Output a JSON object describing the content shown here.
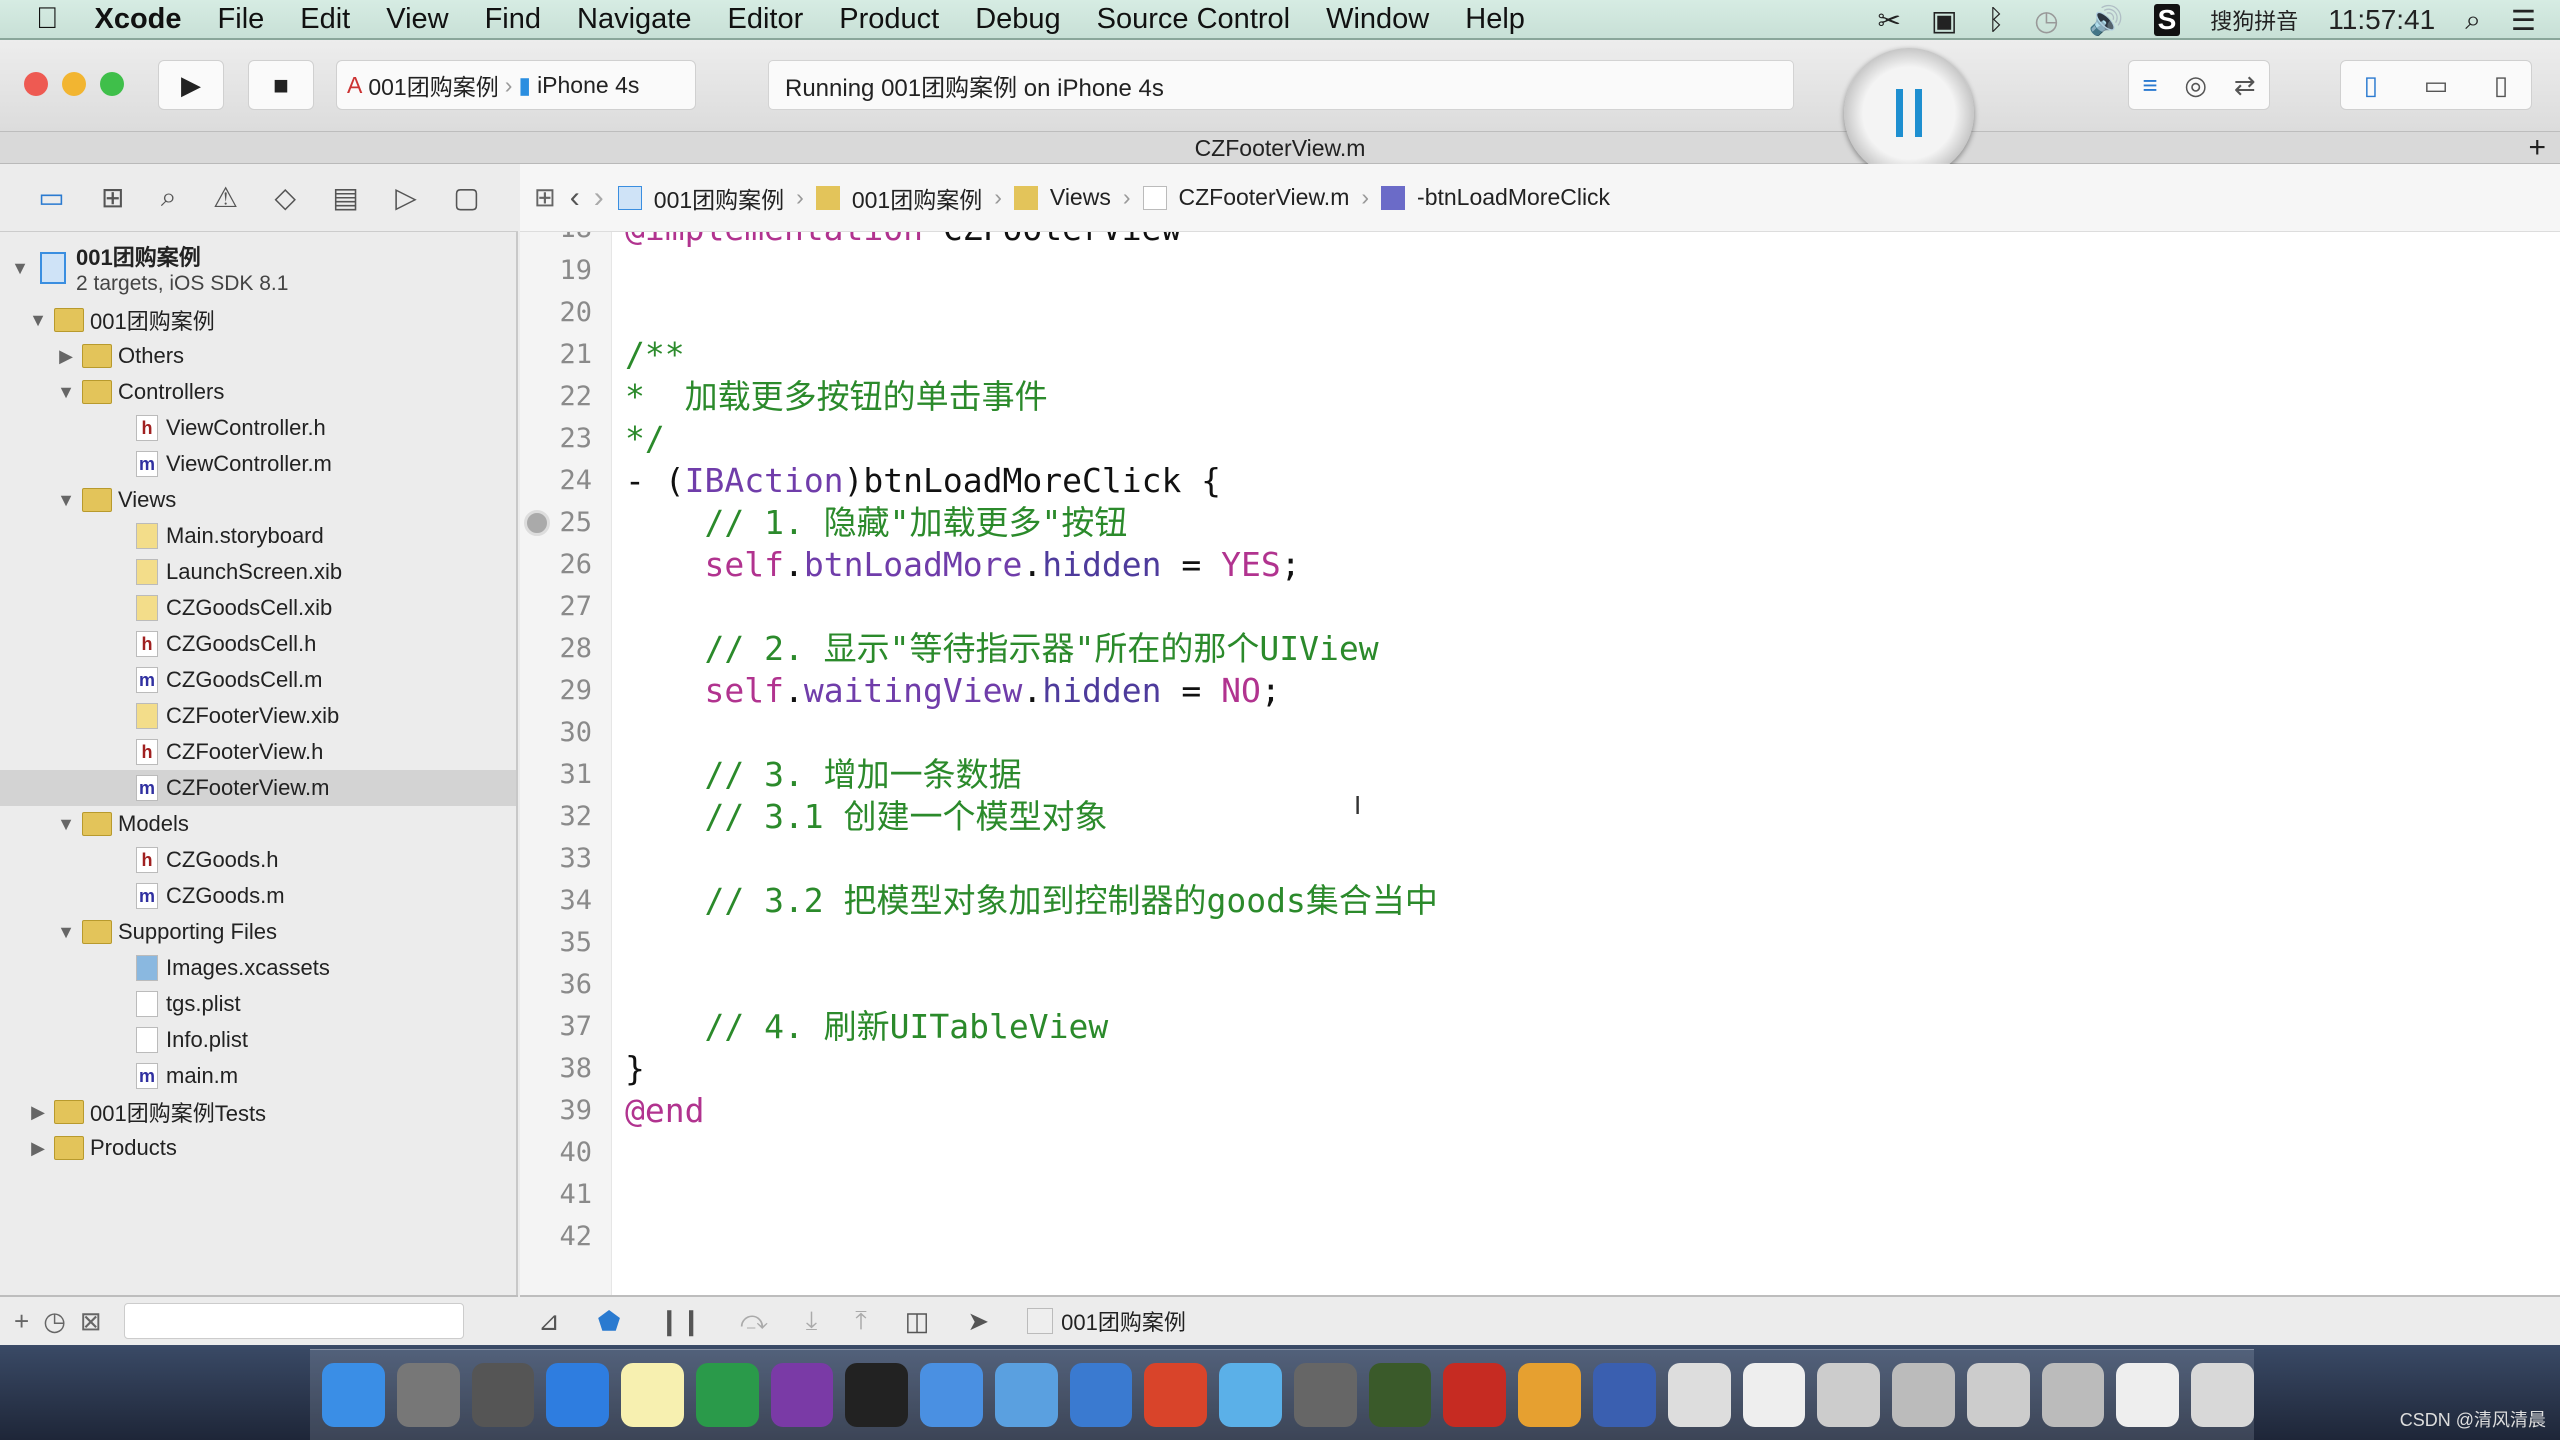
{
  "menubar": {
    "apple": "",
    "items": [
      "Xcode",
      "File",
      "Edit",
      "View",
      "Find",
      "Navigate",
      "Editor",
      "Product",
      "Debug",
      "Source Control",
      "Window",
      "Help"
    ],
    "input_method": "搜狗拼音",
    "clock": "11:57:41"
  },
  "toolbar": {
    "scheme": "001团购案例",
    "device": "iPhone 4s",
    "status": "Running 001团购案例 on iPhone 4s"
  },
  "tab": {
    "title": "CZFooterView.m"
  },
  "jumpbar": [
    "001团购案例",
    "001团购案例",
    "Views",
    "CZFooterView.m",
    "-btnLoadMoreClick"
  ],
  "navigator": {
    "project": {
      "name": "001团购案例",
      "subtitle": "2 targets, iOS SDK 8.1"
    },
    "items": [
      {
        "label": "001团购案例",
        "kind": "folder",
        "depth": 0,
        "open": true
      },
      {
        "label": "Others",
        "kind": "folder",
        "depth": 1,
        "open": false
      },
      {
        "label": "Controllers",
        "kind": "folder",
        "depth": 1,
        "open": true
      },
      {
        "label": "ViewController.h",
        "kind": "h",
        "depth": 2
      },
      {
        "label": "ViewController.m",
        "kind": "m",
        "depth": 2
      },
      {
        "label": "Views",
        "kind": "folder",
        "depth": 1,
        "open": true
      },
      {
        "label": "Main.storyboard",
        "kind": "ib",
        "depth": 2
      },
      {
        "label": "LaunchScreen.xib",
        "kind": "ib",
        "depth": 2
      },
      {
        "label": "CZGoodsCell.xib",
        "kind": "ib",
        "depth": 2
      },
      {
        "label": "CZGoodsCell.h",
        "kind": "h",
        "depth": 2
      },
      {
        "label": "CZGoodsCell.m",
        "kind": "m",
        "depth": 2
      },
      {
        "label": "CZFooterView.xib",
        "kind": "ib",
        "depth": 2
      },
      {
        "label": "CZFooterView.h",
        "kind": "h",
        "depth": 2
      },
      {
        "label": "CZFooterView.m",
        "kind": "m",
        "depth": 2,
        "selected": true
      },
      {
        "label": "Models",
        "kind": "folder",
        "depth": 1,
        "open": true
      },
      {
        "label": "CZGoods.h",
        "kind": "h",
        "depth": 2
      },
      {
        "label": "CZGoods.m",
        "kind": "m",
        "depth": 2
      },
      {
        "label": "Supporting Files",
        "kind": "folder",
        "depth": 1,
        "open": true
      },
      {
        "label": "Images.xcassets",
        "kind": "assets",
        "depth": 2
      },
      {
        "label": "tgs.plist",
        "kind": "plist",
        "depth": 2
      },
      {
        "label": "Info.plist",
        "kind": "plist",
        "depth": 2
      },
      {
        "label": "main.m",
        "kind": "m",
        "depth": 2
      },
      {
        "label": "001团购案例Tests",
        "kind": "folder",
        "depth": 0,
        "open": false
      },
      {
        "label": "Products",
        "kind": "folder",
        "depth": 0,
        "open": false
      }
    ]
  },
  "code": {
    "first_line": 18,
    "breakpoint_line": 25,
    "lines": [
      [
        {
          "t": "@implementation",
          "c": "kw"
        },
        {
          "t": " CZFooterView",
          "c": "pl"
        }
      ],
      [],
      [],
      [
        {
          "t": "/**",
          "c": "cm"
        }
      ],
      [
        {
          "t": "*  加载更多按钮的单击事件",
          "c": "cm"
        }
      ],
      [
        {
          "t": "*/",
          "c": "cm"
        }
      ],
      [
        {
          "t": "- (",
          "c": "pl"
        },
        {
          "t": "IBAction",
          "c": "ty"
        },
        {
          "t": ")btnLoadMoreClick {",
          "c": "pl"
        }
      ],
      [
        {
          "t": "    // 1. 隐藏\"加载更多\"按钮",
          "c": "cm"
        }
      ],
      [
        {
          "t": "    self",
          "c": "kw"
        },
        {
          "t": ".",
          "c": "pl"
        },
        {
          "t": "btnLoadMore",
          "c": "ty"
        },
        {
          "t": ".",
          "c": "pl"
        },
        {
          "t": "hidden",
          "c": "pr"
        },
        {
          "t": " = ",
          "c": "pl"
        },
        {
          "t": "YES",
          "c": "kw"
        },
        {
          "t": ";",
          "c": "pl"
        }
      ],
      [],
      [
        {
          "t": "    // 2. 显示\"等待指示器\"所在的那个UIView",
          "c": "cm"
        }
      ],
      [
        {
          "t": "    self",
          "c": "kw"
        },
        {
          "t": ".",
          "c": "pl"
        },
        {
          "t": "waitingView",
          "c": "ty"
        },
        {
          "t": ".",
          "c": "pl"
        },
        {
          "t": "hidden",
          "c": "pr"
        },
        {
          "t": " = ",
          "c": "pl"
        },
        {
          "t": "NO",
          "c": "kw"
        },
        {
          "t": ";",
          "c": "pl"
        }
      ],
      [],
      [
        {
          "t": "    // 3. 增加一条数据",
          "c": "cm"
        }
      ],
      [
        {
          "t": "    // 3.1 创建一个模型对象",
          "c": "cm"
        }
      ],
      [],
      [
        {
          "t": "    // 3.2 把模型对象加到控制器的goods集合当中",
          "c": "cm"
        }
      ],
      [],
      [],
      [
        {
          "t": "    // 4. 刷新UITableView",
          "c": "cm"
        }
      ],
      [
        {
          "t": "}",
          "c": "pl"
        }
      ],
      [
        {
          "t": "@end",
          "c": "kw"
        }
      ],
      [],
      [],
      []
    ]
  },
  "debugbar": {
    "target": "001团购案例"
  },
  "dock": {
    "icons": [
      "finder",
      "system-preferences",
      "launchpad",
      "safari",
      "notes",
      "excel",
      "onenote",
      "terminal",
      "folder",
      "xcode-instruments",
      "folder-2",
      "powerpoint",
      "screenshot",
      "photo-booth",
      "robinhood",
      "filezilla",
      "app-store",
      "keynote",
      "preview",
      "preview-2",
      "window-1",
      "window-2",
      "window-3",
      "window-4",
      "window-5",
      "trash"
    ],
    "colors": [
      "#3a8ee6",
      "#777",
      "#555",
      "#2e7de0",
      "#f7f0b0",
      "#2a9a4a",
      "#7a3aa6",
      "#222",
      "#4a90e2",
      "#5aa0e0",
      "#3a7ad0",
      "#d9442a",
      "#5bb0e8",
      "#666",
      "#3a5a2a",
      "#c62b22",
      "#e6a030",
      "#3a5fb0",
      "#ddd",
      "#eee",
      "#ccc",
      "#bbb",
      "#ccc",
      "#bbb",
      "#eee",
      "#d8d8d8"
    ]
  },
  "watermark": "CSDN @清风清晨"
}
